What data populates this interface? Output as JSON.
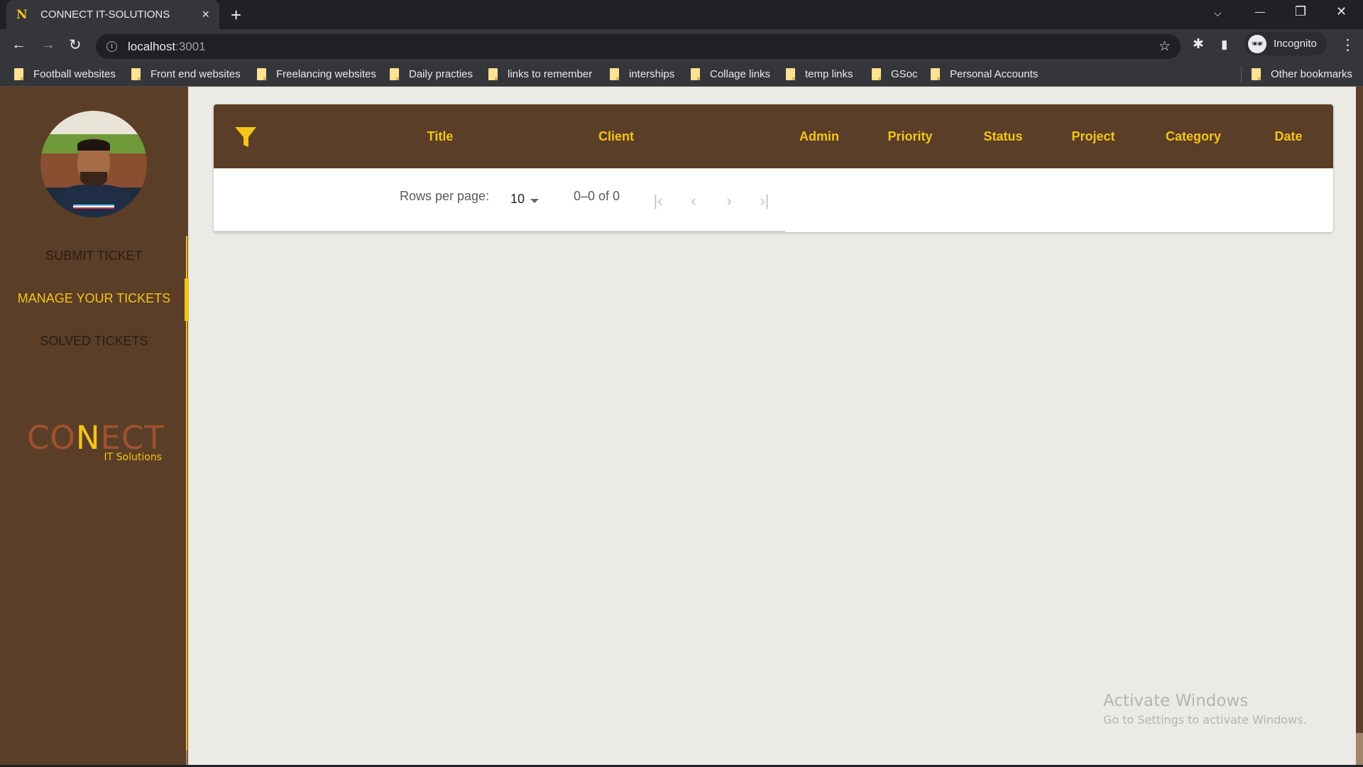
{
  "browser": {
    "tab_title": "CONNECT IT-SOLUTIONS",
    "tab_favicon": "N",
    "url_host": "localhost",
    "url_port": ":3001",
    "profile_label": "Incognito",
    "bookmarks": [
      "Football websites",
      "Front end websites",
      "Freelancing websites",
      "Daily practies",
      "links to remember",
      "interships",
      "Collage links",
      "temp links",
      "GSoc",
      "Personal Accounts"
    ],
    "other_bookmarks": "Other bookmarks",
    "icons": {
      "tab_close": "×",
      "new_tab": "+",
      "tab_search": "⌵",
      "minimize": "—",
      "maximize": "❐",
      "close": "✕",
      "back": "←",
      "forward": "→",
      "reload": "↻",
      "info": "i",
      "star": "☆",
      "extensions": "✱",
      "side_panel": "▮",
      "menu": "⋮",
      "incognito": "🕶"
    }
  },
  "sidebar": {
    "nav": [
      {
        "label": "SUBMIT TICKET",
        "active": false
      },
      {
        "label": "MANAGE YOUR TICKETS",
        "active": true
      },
      {
        "label": "SOLVED TICKETS",
        "active": false
      }
    ],
    "logo": {
      "pre": "CO",
      "mid": "N",
      "post": "ECT",
      "sub": "IT Solutions"
    },
    "accent": "#f5c518",
    "background": "#5a3e28"
  },
  "table": {
    "columns": [
      "Title",
      "Client",
      "Admin",
      "Priority",
      "Status",
      "Project",
      "Category",
      "Date"
    ],
    "rows": [],
    "pagination": {
      "rows_per_page_label": "Rows per page:",
      "rows_per_page": "10",
      "range": "0–0 of 0",
      "first": "|‹",
      "prev": "‹",
      "next": "›",
      "last": "›|"
    }
  },
  "watermark": {
    "title": "Activate Windows",
    "subtitle": "Go to Settings to activate Windows."
  }
}
